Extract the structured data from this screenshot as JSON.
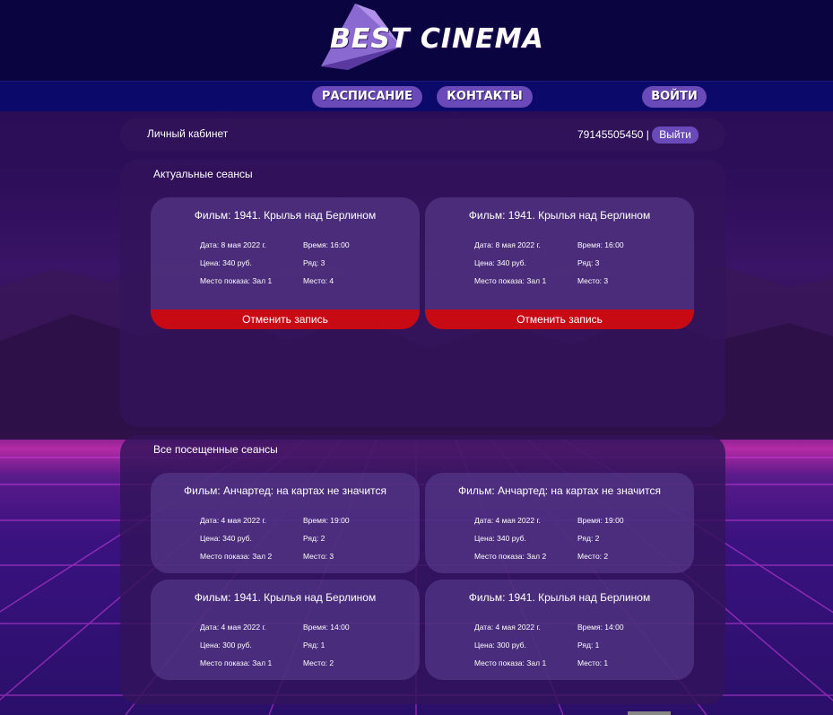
{
  "logo": {
    "text": "BEST CINEMA"
  },
  "nav": {
    "schedule": "Расписание",
    "contacts": "Контакты",
    "login": "Войти"
  },
  "account": {
    "title": "Личный кабинет",
    "phone": "79145505450 |",
    "logout": "Выйти"
  },
  "current": {
    "title": "Актуальные сеансы",
    "cancel_label": "Отменить запись",
    "sessions": [
      {
        "film": "Фильм: 1941. Крылья над Берлином",
        "date": "Дата: 8 мая 2022 г.",
        "time": "Время: 16:00",
        "price": "Цена: 340 руб.",
        "row": "Ряд: 3",
        "hall": "Место показа: Зал 1",
        "seat": "Место: 4"
      },
      {
        "film": "Фильм: 1941. Крылья над Берлином",
        "date": "Дата: 8 мая 2022 г.",
        "time": "Время: 16:00",
        "price": "Цена: 340 руб.",
        "row": "Ряд: 3",
        "hall": "Место показа: Зал 1",
        "seat": "Место: 3"
      }
    ]
  },
  "visited": {
    "title": "Все посещенные сеансы",
    "sessions": [
      {
        "film": "Фильм: Анчартед: на картах не значится",
        "date": "Дата: 4 мая 2022 г.",
        "time": "Время: 19:00",
        "price": "Цена: 340 руб.",
        "row": "Ряд: 2",
        "hall": "Место показа: Зал 2",
        "seat": "Место: 3"
      },
      {
        "film": "Фильм: Анчартед: на картах не значится",
        "date": "Дата: 4 мая 2022 г.",
        "time": "Время: 19:00",
        "price": "Цена: 340 руб.",
        "row": "Ряд: 2",
        "hall": "Место показа: Зал 2",
        "seat": "Место: 2"
      },
      {
        "film": "Фильм: 1941. Крылья над Берлином",
        "date": "Дата: 4 мая 2022 г.",
        "time": "Время: 14:00",
        "price": "Цена: 300 руб.",
        "row": "Ряд: 1",
        "hall": "Место показа: Зал 1",
        "seat": "Место: 2"
      },
      {
        "film": "Фильм: 1941. Крылья над Берлином",
        "date": "Дата: 4 мая 2022 г.",
        "time": "Время: 14:00",
        "price": "Цена: 300 руб.",
        "row": "Ряд: 1",
        "hall": "Место показа: Зал 1",
        "seat": "Место: 1"
      }
    ]
  },
  "colors": {
    "topbar": "#0a0540",
    "navbar": "#0b0a6a",
    "button": "#6a4ab8",
    "cancel": "#c80a14"
  }
}
